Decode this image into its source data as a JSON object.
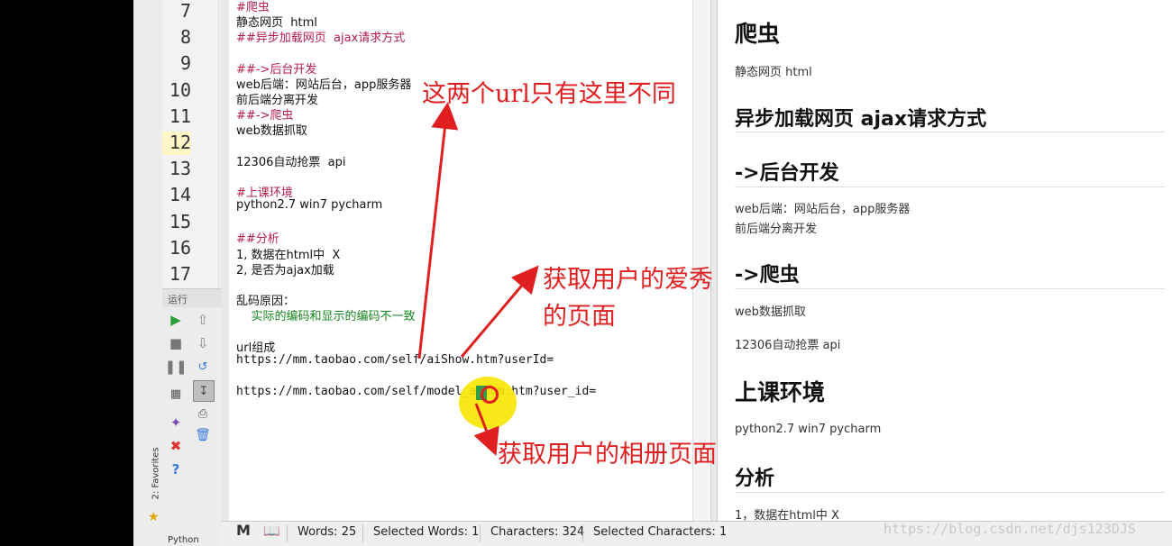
{
  "line_numbers": [
    "7",
    "8",
    "9",
    "10",
    "11",
    "12",
    "13",
    "14",
    "15",
    "16",
    "17"
  ],
  "active_line": "12",
  "run_label": "运行",
  "favorites_label": "2: Favorites",
  "python_tab": "Python",
  "editor_lines": [
    {
      "text": "#爬虫",
      "style": "h"
    },
    {
      "text": "静态网页  html",
      "style": ""
    },
    {
      "text": "##异步加载网页  ajax请求方式",
      "style": "h"
    },
    {
      "text": "##->后台开发",
      "style": "h"
    },
    {
      "text": "web后端：网站后台，app服务器",
      "style": ""
    },
    {
      "text": "前后端分离开发",
      "style": ""
    },
    {
      "text": "##->爬虫",
      "style": "h"
    },
    {
      "text": "web数据抓取",
      "style": ""
    },
    {
      "text": "12306自动抢票  api",
      "style": ""
    },
    {
      "text": "#上课环境",
      "style": "h"
    },
    {
      "text": "python2.7 win7 pycharm",
      "style": ""
    },
    {
      "text": "##分析",
      "style": "h"
    },
    {
      "text": "1, 数据在html中  X",
      "style": ""
    },
    {
      "text": "2, 是否为ajax加载",
      "style": ""
    },
    {
      "text": "乱码原因：",
      "style": ""
    },
    {
      "text": "    实际的编码和显示的编码不一致",
      "style": "g"
    },
    {
      "text": "url组成",
      "style": ""
    },
    {
      "text": "https://mm.taobao.com/self/aiShow.htm?userId=",
      "style": "mono"
    },
    {
      "text": "https://mm.taobao.com/self/model_album.htm?user_id=",
      "style": "mono"
    }
  ],
  "preview": {
    "h1": "爬虫",
    "p1": "静态网页 html",
    "h2_async": "异步加载网页 ajax请求方式",
    "h2_backend": "->后台开发",
    "p_backend_1": "web后端：网站后台，app服务器",
    "p_backend_2": "前后端分离开发",
    "h2_crawler": "->爬虫",
    "p_crawler": "web数据抓取",
    "p_12306": "12306自动抢票 api",
    "h1_env": "上课环境",
    "p_env": "python2.7 win7 pycharm",
    "h2_analysis": "分析",
    "p_analysis": "1，数据在html中 X"
  },
  "status": {
    "words": "Words: 25",
    "selected_words": "Selected Words: 1",
    "characters": "Characters: 324",
    "selected_characters": "Selected Characters: 1"
  },
  "annotations": {
    "top_note": "这两个url只有这里不同",
    "middle_note_1": "获取用户的爱秀",
    "middle_note_2": "的页面",
    "bottom_note": "获取用户的相册页面"
  },
  "watermark": "https://blog.csdn.net/djs123DJS",
  "colors": {
    "annotation_red": "#e02020",
    "heading_magenta": "#b51c4a",
    "comment_green": "#15851d",
    "cursor_yellow": "#f7e600"
  }
}
